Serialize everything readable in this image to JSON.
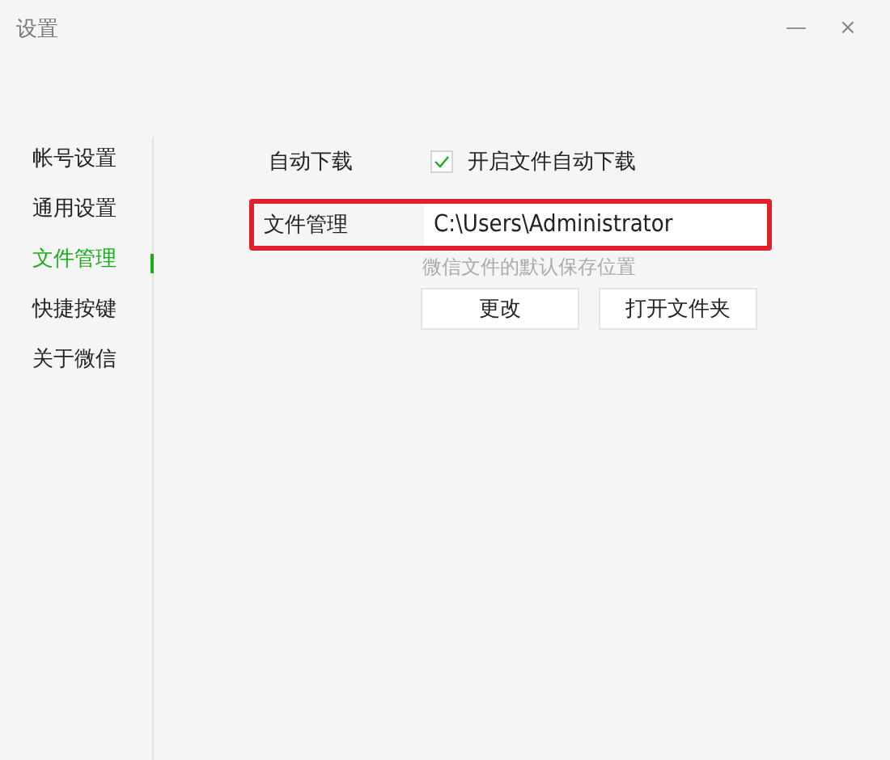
{
  "window": {
    "title": "设置",
    "controls": [
      "—",
      "×"
    ]
  },
  "sidebar": {
    "items": [
      {
        "label": "帐号设置",
        "selected": false
      },
      {
        "label": "通用设置",
        "selected": false
      },
      {
        "label": "文件管理",
        "selected": true
      },
      {
        "label": "快捷按键",
        "selected": false
      },
      {
        "label": "关于微信",
        "selected": false
      }
    ]
  },
  "auto_download": {
    "label": "自动下载",
    "option": "开启文件自动下载",
    "checked": true
  },
  "file_management": {
    "label": "文件管理",
    "path": "C:\\Users\\Administrator",
    "hint": "微信文件的默认保存位置",
    "highlighted": true,
    "buttons": [
      "更改",
      "打开文件夹"
    ]
  }
}
